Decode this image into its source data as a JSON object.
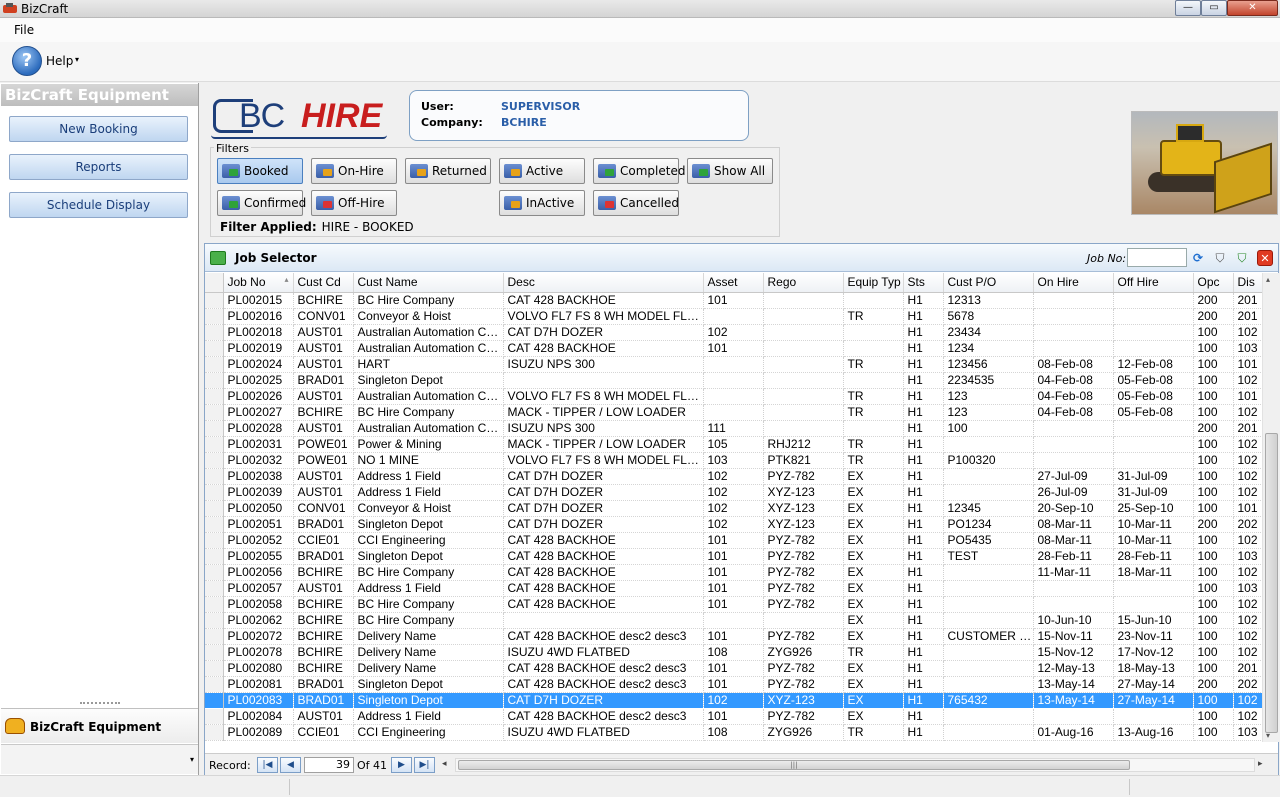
{
  "window": {
    "title": "BizCraft",
    "min_glyph": "—",
    "max_glyph": "▭",
    "close_glyph": "✕"
  },
  "menu": {
    "file": "File"
  },
  "toolbar": {
    "help_label": "Help",
    "help_glyph": "?",
    "caret": "▾"
  },
  "sidebar": {
    "header": "BizCraft Equipment",
    "items": [
      "New Booking",
      "Reports",
      "Schedule Display"
    ],
    "panel_label": "BizCraft Equipment",
    "caret": "▾"
  },
  "logo": {
    "bc": "BC",
    "hire": "HIRE"
  },
  "user": {
    "user_label": "User:",
    "user_value": "SUPERVISOR",
    "company_label": "Company:",
    "company_value": "BCHIRE"
  },
  "filters": {
    "title": "Filters",
    "buttons": [
      {
        "label": "Booked",
        "icon": "booked-icon",
        "active": true
      },
      {
        "label": "On-Hire",
        "icon": "on-hire-icon",
        "active": false
      },
      {
        "label": "Returned",
        "icon": "returned-icon",
        "active": false
      },
      {
        "label": "Active",
        "icon": "active-icon",
        "active": false
      },
      {
        "label": "Completed",
        "icon": "completed-icon",
        "active": false
      },
      {
        "label": "Show All",
        "icon": "show-all-icon",
        "active": false
      },
      {
        "label": "Confirmed",
        "icon": "confirmed-icon",
        "active": false
      },
      {
        "label": "Off-Hire",
        "icon": "off-hire-icon",
        "active": false
      },
      {
        "label": "InActive",
        "icon": "inactive-icon",
        "active": false
      },
      {
        "label": "Cancelled",
        "icon": "cancelled-icon",
        "active": false
      }
    ],
    "applied_label": "Filter Applied:",
    "applied_value": "HIRE - BOOKED"
  },
  "job_panel": {
    "title": "Job Selector",
    "job_no_label": "Job No:",
    "job_no_value": "",
    "refresh_glyph": "⟳",
    "filter_glyph": "⛉",
    "clear_filter_glyph": "⛉",
    "close_glyph": "✕"
  },
  "grid": {
    "sort_glyph": "▴",
    "columns": [
      "Job No",
      "Cust Cd",
      "Cust Name",
      "Desc",
      "Asset",
      "Rego",
      "Equip Typ",
      "Sts",
      "Cust P/O",
      "On Hire",
      "Off Hire",
      "Opc",
      "Dis"
    ],
    "selected_row": 25,
    "rows": [
      [
        "PL002015",
        "BCHIRE",
        "BC Hire Company",
        "CAT 428 BACKHOE",
        "101",
        "",
        "",
        "H1",
        "12313",
        "",
        "",
        "200",
        "201"
      ],
      [
        "PL002016",
        "CONV01",
        "Conveyor & Hoist",
        "VOLVO FL7 FS 8 WH MODEL FL7F...",
        "",
        "",
        "TR",
        "H1",
        "5678",
        "",
        "",
        "200",
        "201"
      ],
      [
        "PL002018",
        "AUST01",
        "Australian Automation Cen...",
        "CAT D7H DOZER",
        "102",
        "",
        "",
        "H1",
        "23434",
        "",
        "",
        "100",
        "102"
      ],
      [
        "PL002019",
        "AUST01",
        "Australian Automation Cen...",
        "CAT 428 BACKHOE",
        "101",
        "",
        "",
        "H1",
        "1234",
        "",
        "",
        "100",
        "103"
      ],
      [
        "PL002024",
        "AUST01",
        "HART",
        "ISUZU NPS 300",
        "",
        "",
        "TR",
        "H1",
        "123456",
        "08-Feb-08",
        "12-Feb-08",
        "100",
        "101"
      ],
      [
        "PL002025",
        "BRAD01",
        "Singleton Depot",
        "",
        "",
        "",
        "",
        "H1",
        "2234535",
        "04-Feb-08",
        "05-Feb-08",
        "100",
        "102"
      ],
      [
        "PL002026",
        "AUST01",
        "Australian Automation Cen...",
        "VOLVO FL7 FS 8 WH MODEL FL7F...",
        "",
        "",
        "TR",
        "H1",
        "123",
        "04-Feb-08",
        "05-Feb-08",
        "100",
        "101"
      ],
      [
        "PL002027",
        "BCHIRE",
        "BC Hire Company",
        "MACK - TIPPER / LOW LOADER",
        "",
        "",
        "TR",
        "H1",
        "123",
        "04-Feb-08",
        "05-Feb-08",
        "100",
        "102"
      ],
      [
        "PL002028",
        "AUST01",
        "Australian Automation Cen...",
        "ISUZU NPS 300",
        "111",
        "",
        "",
        "H1",
        "100",
        "",
        "",
        "200",
        "201"
      ],
      [
        "PL002031",
        "POWE01",
        "Power & Mining",
        "MACK - TIPPER / LOW LOADER",
        "105",
        "RHJ212",
        "TR",
        "H1",
        "",
        "",
        "",
        "100",
        "102"
      ],
      [
        "PL002032",
        "POWE01",
        "NO 1 MINE",
        "VOLVO FL7 FS 8 WH MODEL FL7F...",
        "103",
        "PTK821",
        "TR",
        "H1",
        "P100320",
        "",
        "",
        "100",
        "102"
      ],
      [
        "PL002038",
        "AUST01",
        "Address 1 Field",
        "CAT D7H DOZER",
        "102",
        "PYZ-782",
        "EX",
        "H1",
        "",
        "27-Jul-09",
        "31-Jul-09",
        "100",
        "102"
      ],
      [
        "PL002039",
        "AUST01",
        "Address 1 Field",
        "CAT D7H DOZER",
        "102",
        "XYZ-123",
        "EX",
        "H1",
        "",
        "26-Jul-09",
        "31-Jul-09",
        "100",
        "102"
      ],
      [
        "PL002050",
        "CONV01",
        "Conveyor & Hoist",
        "CAT D7H DOZER",
        "102",
        "XYZ-123",
        "EX",
        "H1",
        "12345",
        "20-Sep-10",
        "25-Sep-10",
        "100",
        "101"
      ],
      [
        "PL002051",
        "BRAD01",
        "Singleton Depot",
        "CAT D7H DOZER",
        "102",
        "XYZ-123",
        "EX",
        "H1",
        "PO1234",
        "08-Mar-11",
        "10-Mar-11",
        "200",
        "202"
      ],
      [
        "PL002052",
        "CCIE01",
        "CCI Engineering",
        "CAT 428 BACKHOE",
        "101",
        "PYZ-782",
        "EX",
        "H1",
        "PO5435",
        "08-Mar-11",
        "10-Mar-11",
        "100",
        "102"
      ],
      [
        "PL002055",
        "BRAD01",
        "Singleton Depot",
        "CAT 428 BACKHOE",
        "101",
        "PYZ-782",
        "EX",
        "H1",
        "TEST",
        "28-Feb-11",
        "28-Feb-11",
        "100",
        "103"
      ],
      [
        "PL002056",
        "BCHIRE",
        "BC Hire Company",
        "CAT 428 BACKHOE",
        "101",
        "PYZ-782",
        "EX",
        "H1",
        "",
        "11-Mar-11",
        "18-Mar-11",
        "100",
        "102"
      ],
      [
        "PL002057",
        "AUST01",
        "Address 1 Field",
        "CAT 428 BACKHOE",
        "101",
        "PYZ-782",
        "EX",
        "H1",
        "",
        "",
        "",
        "100",
        "103"
      ],
      [
        "PL002058",
        "BCHIRE",
        "BC Hire Company",
        "CAT 428 BACKHOE",
        "101",
        "PYZ-782",
        "EX",
        "H1",
        "",
        "",
        "",
        "100",
        "102"
      ],
      [
        "PL002062",
        "BCHIRE",
        "BC Hire Company",
        "",
        "",
        "",
        "EX",
        "H1",
        "",
        "10-Jun-10",
        "15-Jun-10",
        "100",
        "102"
      ],
      [
        "PL002072",
        "BCHIRE",
        "Delivery Name",
        "CAT 428 BACKHOE desc2 desc3",
        "101",
        "PYZ-782",
        "EX",
        "H1",
        "CUSTOMER P...",
        "15-Nov-11",
        "23-Nov-11",
        "100",
        "102"
      ],
      [
        "PL002078",
        "BCHIRE",
        "Delivery Name",
        "ISUZU 4WD FLATBED",
        "108",
        "ZYG926",
        "TR",
        "H1",
        "",
        "15-Nov-12",
        "17-Nov-12",
        "100",
        "102"
      ],
      [
        "PL002080",
        "BCHIRE",
        "Delivery Name",
        "CAT 428 BACKHOE desc2 desc3",
        "101",
        "PYZ-782",
        "EX",
        "H1",
        "",
        "12-May-13",
        "18-May-13",
        "100",
        "201"
      ],
      [
        "PL002081",
        "BRAD01",
        "Singleton Depot",
        "CAT 428 BACKHOE desc2 desc3",
        "101",
        "PYZ-782",
        "EX",
        "H1",
        "",
        "13-May-14",
        "27-May-14",
        "200",
        "202"
      ],
      [
        "PL002083",
        "BRAD01",
        "Singleton Depot",
        "CAT D7H DOZER",
        "102",
        "XYZ-123",
        "EX",
        "H1",
        "765432",
        "13-May-14",
        "27-May-14",
        "100",
        "102"
      ],
      [
        "PL002084",
        "AUST01",
        "Address 1 Field",
        "CAT 428 BACKHOE desc2 desc3",
        "101",
        "PYZ-782",
        "EX",
        "H1",
        "",
        "",
        "",
        "100",
        "102"
      ],
      [
        "PL002089",
        "CCIE01",
        "CCI Engineering",
        "ISUZU 4WD FLATBED",
        "108",
        "ZYG926",
        "TR",
        "H1",
        "",
        "01-Aug-16",
        "13-Aug-16",
        "100",
        "103"
      ]
    ]
  },
  "navigator": {
    "record_label": "Record:",
    "position": "39",
    "of_label": "Of",
    "total": "41",
    "first_glyph": "|◀",
    "prev_glyph": "◀",
    "next_glyph": "▶",
    "last_glyph": "▶|",
    "left_glyph": "◂",
    "right_glyph": "▸",
    "grip_glyph": "|||",
    "up_glyph": "▴",
    "down_glyph": "▾"
  }
}
